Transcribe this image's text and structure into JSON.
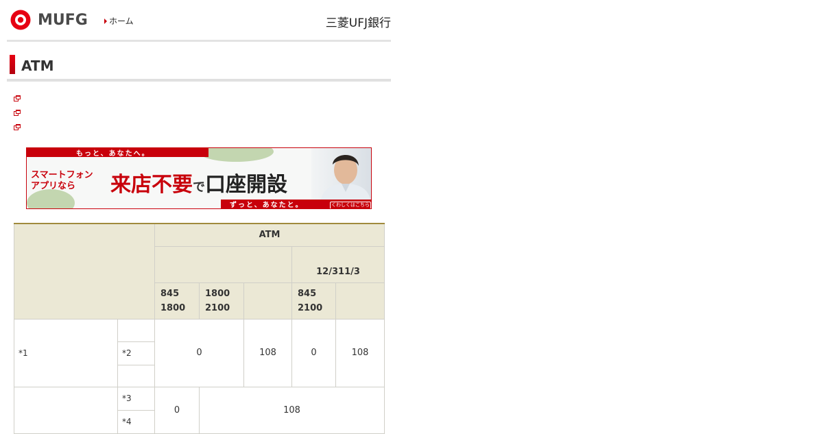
{
  "header": {
    "brand": "MUFG",
    "home_link": "ホーム",
    "bank_name": "三菱UFJ銀行"
  },
  "page_title": "ATM",
  "links": [
    {
      "label": ""
    },
    {
      "label": ""
    },
    {
      "label": ""
    }
  ],
  "banner": {
    "top_text": "もっと、あなたへ。",
    "bottom_text": "ずっと、あなたと。",
    "app_line1": "スマートフォン",
    "app_line2": "アプリなら",
    "main_red": "来店不要",
    "main_particle": "で",
    "main_black": "口座開設",
    "button": "くわしくはこちら"
  },
  "table": {
    "atm_header": "ATM",
    "period_header": "12/311/3",
    "time_slots": [
      {
        "start": "845",
        "end": "1800"
      },
      {
        "start": "1800",
        "end": "2100"
      },
      {
        "start": "845",
        "end": "2100"
      }
    ],
    "row1": {
      "note": "*1",
      "sub_note": "*2",
      "fee_weekday_a": "0",
      "fee_weekday_b": "108",
      "fee_holiday_a": "0",
      "fee_holiday_b": "108"
    },
    "row2": {
      "sub_note_a": "*3",
      "sub_note_b": "*4",
      "fee_a": "0",
      "fee_b": "108"
    }
  },
  "colors": {
    "brand_red": "#c8000b",
    "table_header_bg": "#ebe8d5",
    "table_top_border": "#a08a3c"
  }
}
